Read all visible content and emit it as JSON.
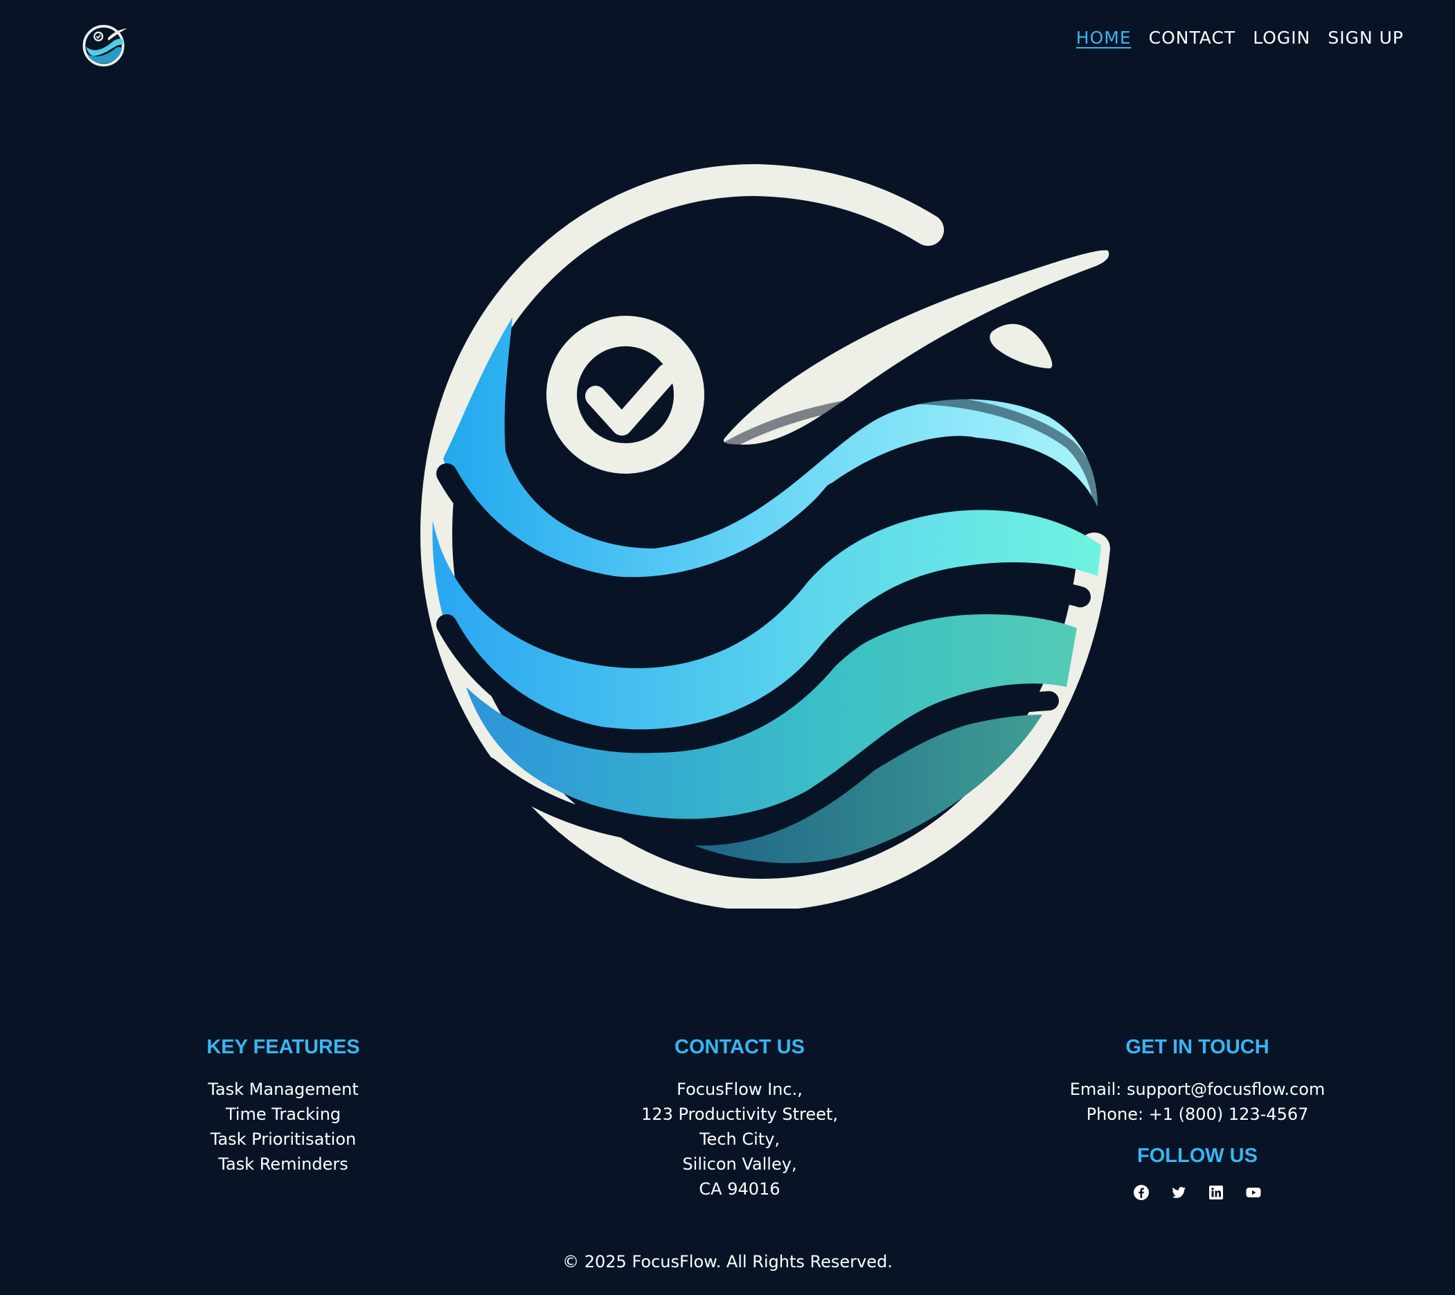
{
  "header": {
    "logo_icon": "focusflow-wave-logo-icon",
    "nav": [
      {
        "label": "HOME",
        "active": true
      },
      {
        "label": "CONTACT",
        "active": false
      },
      {
        "label": "LOGIN",
        "active": false
      },
      {
        "label": "SIGN UP",
        "active": false
      }
    ]
  },
  "hero": {
    "image_icon": "focusflow-wave-checkmark-emblem"
  },
  "footer": {
    "features": {
      "title": "KEY FEATURES",
      "items": [
        "Task Management",
        "Time Tracking",
        "Task Prioritisation",
        "Task Reminders"
      ]
    },
    "contact": {
      "title": "CONTACT US",
      "lines": [
        "FocusFlow Inc.,",
        "123 Productivity Street,",
        "Tech City,",
        "Silicon Valley,",
        "CA 94016"
      ]
    },
    "touch": {
      "title": "GET IN TOUCH",
      "email": "Email: support@focusflow.com",
      "phone": "Phone: +1 (800) 123-4567",
      "follow_title": "FOLLOW US",
      "social_icons": [
        "facebook-icon",
        "twitter-icon",
        "linkedin-icon",
        "youtube-icon"
      ]
    },
    "copyright": "© 2025 FocusFlow. All Rights Reserved."
  },
  "colors": {
    "background": "#081426",
    "accent": "#38b6f2",
    "text": "#ffffff"
  }
}
